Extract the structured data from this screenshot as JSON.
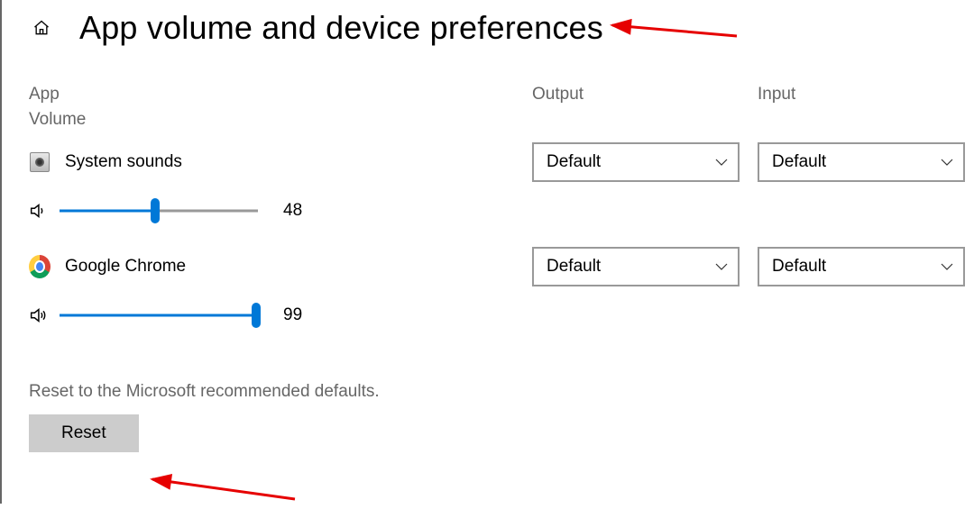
{
  "header": {
    "title": "App volume and device preferences"
  },
  "columns": {
    "app": "App",
    "output": "Output",
    "input": "Input"
  },
  "volume_label": "Volume",
  "apps": [
    {
      "icon": "system-sounds-icon",
      "name": "System sounds",
      "volume": 48,
      "output": "Default",
      "input": "Default"
    },
    {
      "icon": "chrome-icon",
      "name": "Google Chrome",
      "volume": 99,
      "output": "Default",
      "input": "Default"
    }
  ],
  "reset": {
    "description": "Reset to the Microsoft recommended defaults.",
    "button": "Reset"
  }
}
